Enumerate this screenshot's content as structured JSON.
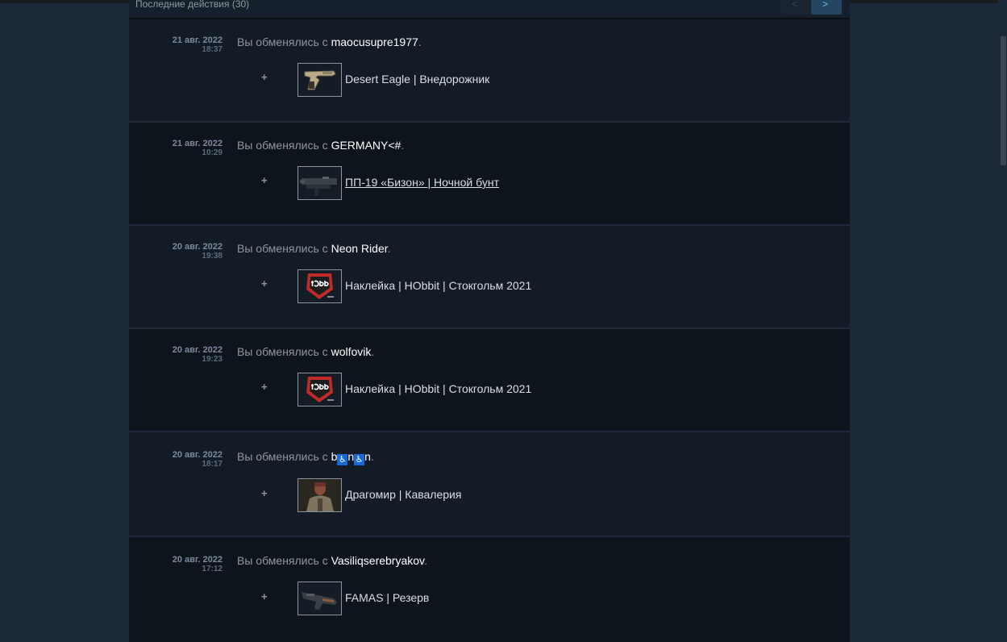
{
  "header": {
    "title": "Последние действия (30)"
  },
  "pagination": {
    "prev_icon": "chevron-left-icon",
    "next_icon": "chevron-right-icon",
    "prev": "<",
    "next": ">"
  },
  "trade_prefix": "Вы обменялись с ",
  "trade_suffix": ".",
  "plus": "+",
  "entries": [
    {
      "date": "21 авг. 2022",
      "time": "18:37",
      "user": "maocusupre1977",
      "item": "Desert Eagle | Внедорожник",
      "icon": "pistol-icon"
    },
    {
      "date": "21 авг. 2022",
      "time": "10:29",
      "user": "GERMANY<#",
      "item": "ПП-19 «Бизон» | Ночной бунт",
      "icon": "smg-icon"
    },
    {
      "date": "20 авг. 2022",
      "time": "19:38",
      "user": "Neon Rider",
      "item": "Наклейка | HObbit | Стокгольм 2021",
      "icon": "sticker-icon"
    },
    {
      "date": "20 авг. 2022",
      "time": "19:23",
      "user": "wolfovik",
      "item": "Наклейка | HObbit | Стокгольм 2021",
      "icon": "sticker-icon"
    },
    {
      "date": "20 авг. 2022",
      "time": "18:17",
      "user_parts": [
        "b",
        "♿",
        "n",
        "♿",
        "n"
      ],
      "item": "Драгомир | Кавалерия",
      "icon": "agent-icon"
    },
    {
      "date": "20 авг. 2022",
      "time": "17:12",
      "user": "Vasiliqserebryakov",
      "item": "FAMAS | Резерв",
      "icon": "rifle-icon"
    }
  ],
  "colors": {
    "background": "#1b2838",
    "panel": "#0f1621",
    "user": "#ffffff",
    "text": "#8f98a0",
    "sticker_red": "#c22a2a"
  }
}
